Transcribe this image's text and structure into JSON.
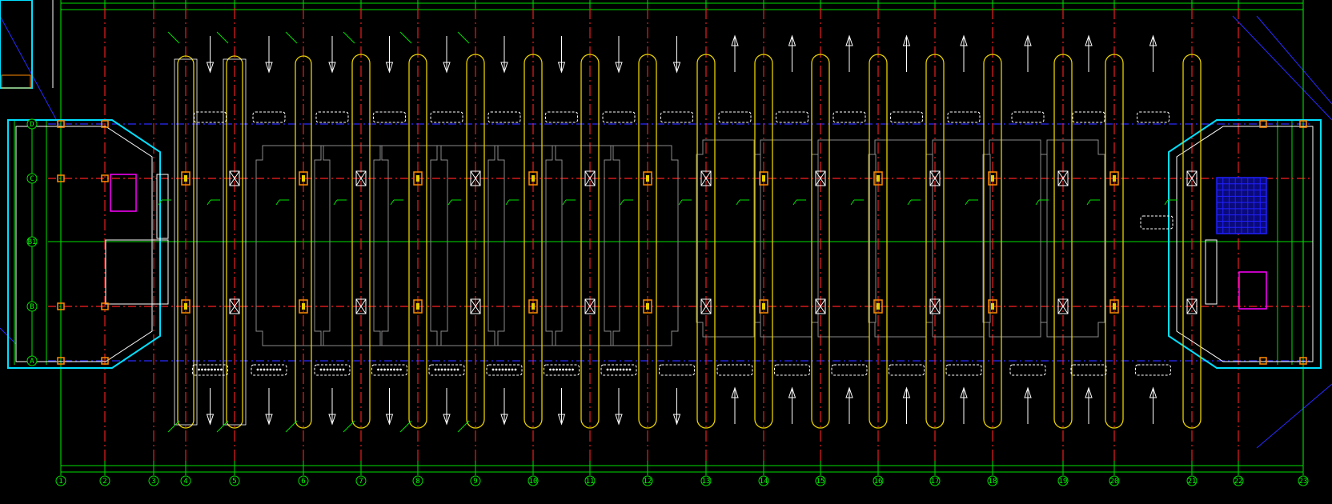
{
  "drawing": {
    "colors": {
      "background": "#000000",
      "axis_red": "#ff2020",
      "axis_blue": "#2a2aff",
      "grid_green": "#00e000",
      "column_yellow": "#e8d000",
      "wall_cyan": "#00e0ff",
      "wall_white": "#ffffff",
      "lobby_blue": "#2020ff",
      "toilet_magenta": "#ff00ff",
      "orange": "#ff8c00",
      "outline_grey": "#8a8a8a",
      "text": "#d8d8d8"
    },
    "vertical_axes": [
      "1",
      "2",
      "3",
      "4",
      "5",
      "6",
      "7",
      "8",
      "9",
      "10",
      "11",
      "12",
      "13",
      "14",
      "15",
      "16",
      "17",
      "18",
      "19",
      "20",
      "21",
      "22",
      "23"
    ],
    "horizontal_axes": [
      "D",
      "C",
      "B1",
      "B",
      "A"
    ],
    "column_strip_count": 18,
    "bay_arrow_direction": [
      "down",
      "down",
      "down",
      "down",
      "down",
      "down",
      "down",
      "down",
      "down",
      "up",
      "up",
      "up",
      "up",
      "up",
      "up",
      "up",
      "up",
      "up"
    ]
  }
}
